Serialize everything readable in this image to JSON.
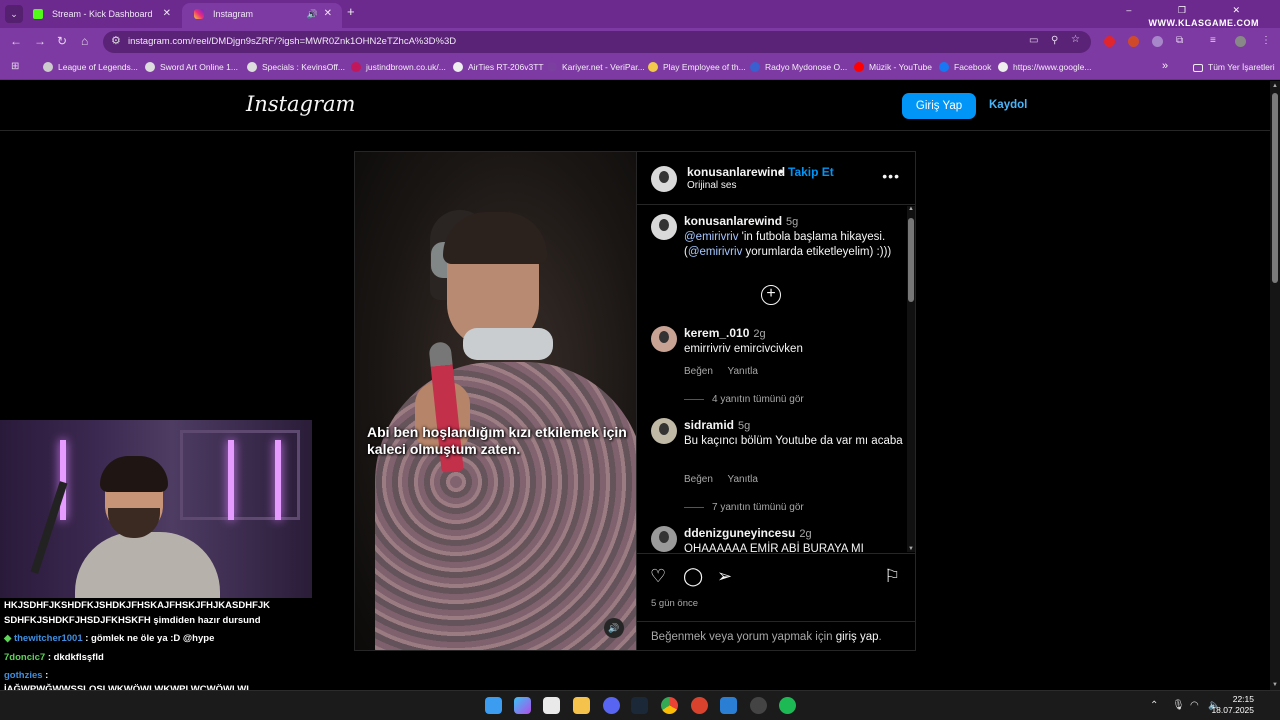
{
  "browser": {
    "tabs": [
      {
        "label": "Stream - Kick Dashboard",
        "close": "✕"
      },
      {
        "label": "Instagram",
        "close": "✕",
        "audio": "🔊"
      }
    ],
    "new_tab": "+",
    "window_controls": "–  ❐  ✕",
    "watermark": "WWW.KLASGAME.COM",
    "url": "instagram.com/reel/DMDjgn9sZRF/?igsh=MWR0Znk1OHN2eTZhcA%3D%3D",
    "bookmarks": [
      "League of Legends...",
      "Sword Art Online 1...",
      "Specials : KevinsOff...",
      "justindbrown.co.uk/...",
      "AirTies RT-206v3TT",
      "Kariyer.net - VeriPar...",
      "Play Employee of th...",
      "Radyo Mydonose O...",
      "Müzik - YouTube",
      "Facebook",
      "https://www.google..."
    ],
    "bookmarks_overflow": "»",
    "all_bookmarks": "Tüm Yer İşaretleri"
  },
  "instagram": {
    "logo": "Instagram",
    "login_button": "Giriş Yap",
    "signup_link": "Kaydol",
    "post": {
      "subtitle": "Abi ben hoşlandığım kızı etkilemek için kaleci olmuştum zaten.",
      "username": "konusanlarewind",
      "follow_separator": "•",
      "follow": "Takip Et",
      "audio": "Orijinal ses",
      "caption": {
        "user": "konusanlarewind",
        "time": "5g",
        "mention1": "@emirivriv",
        "text1": " 'in futbola başlama hikayesi. (",
        "mention2": "@emirivriv",
        "text2": " yorumlarda etiketleyelim) :)))"
      },
      "comments": [
        {
          "user": "kerem_.010",
          "time": "2g",
          "text": "emirrivriv emircivcivken",
          "like": "Beğen",
          "reply": "Yanıtla",
          "view_replies": "4 yanıtın tümünü gör"
        },
        {
          "user": "sidramid",
          "time": "5g",
          "text": "Bu kaçıncı bölüm Youtube da var mı acaba",
          "like": "Beğen",
          "reply": "Yanıtla",
          "view_replies": "7 yanıtın tümünü gör"
        },
        {
          "user": "ddenizguneyincesu",
          "time": "2g",
          "text": "OHAAAAAA EMİR ABİ BURAYA MI"
        }
      ],
      "posted": "5 gün önce",
      "login_prompt_prefix": "Beğenmek veya yorum yapmak için ",
      "login_prompt_link": "giriş yap",
      "login_prompt_suffix": "."
    }
  },
  "stream_chat": {
    "line1": "HKJSDHFJKSHDFKJSHDKJFHSKAJFHSKJFHJKASDHFJK",
    "line2": "SDHFKJSHDKFJHSDJFKHSKFH şimdiden hazır dursund",
    "messages": [
      {
        "user": "thewitcher1001",
        "text": ": gömlek ne öle ya :D @hype"
      },
      {
        "user": "7doncic7",
        "text": ": dkdkflsşfld"
      },
      {
        "user": "gothzies",
        "text": ":"
      }
    ],
    "line_last": "İAĞWPWĞWWŞSLOSLWKWÖWLWKWPLWÇWÖWLWL"
  },
  "taskbar": {
    "time": "22:15",
    "date": "18.07.2025"
  },
  "colors": {
    "browser_frame": "#7e3aa3",
    "ig_blue": "#0095f6",
    "background": "#000000"
  }
}
